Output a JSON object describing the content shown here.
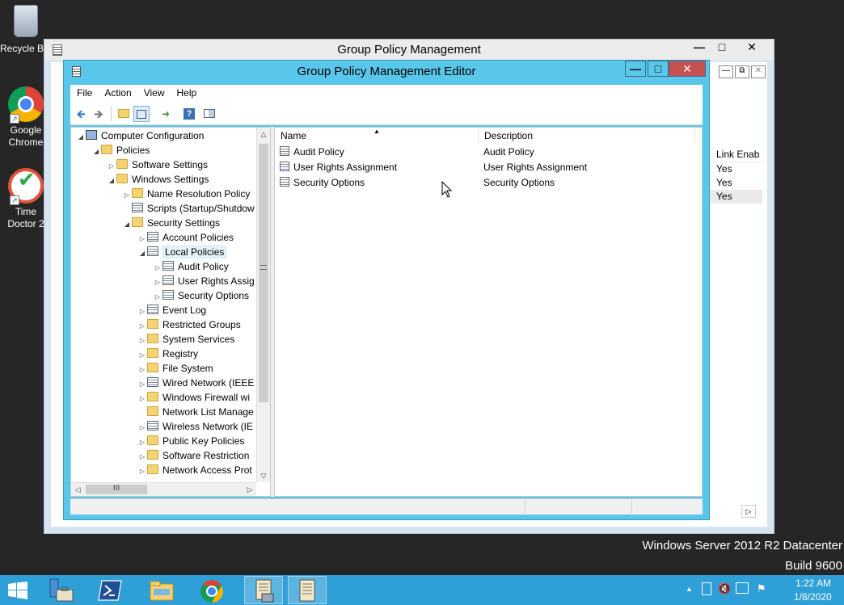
{
  "desktop": {
    "icons": [
      {
        "label": "Recycle Bin",
        "icon": "recycle-bin-icon"
      },
      {
        "label": "Google Chrome",
        "icon": "chrome-icon"
      },
      {
        "label": "Time Doctor 2",
        "icon": "time-doctor-icon"
      }
    ],
    "watermark_line1": "Windows Server 2012 R2 Datacenter",
    "watermark_line2": "Build 9600"
  },
  "gpm_window": {
    "title": "Group Policy Management",
    "right_column_header": "Link Enab",
    "right_column_values": [
      "Yes",
      "Yes",
      "Yes"
    ]
  },
  "editor": {
    "title": "Group Policy Management Editor",
    "menu": [
      "File",
      "Action",
      "View",
      "Help"
    ],
    "tree": [
      {
        "label": "Computer Configuration",
        "expanded": true
      },
      {
        "label": "Policies",
        "expanded": true
      },
      {
        "label": "Software Settings",
        "expanded": false
      },
      {
        "label": "Windows Settings",
        "expanded": true
      },
      {
        "label": "Name Resolution Policy",
        "expanded": false
      },
      {
        "label": "Scripts (Startup/Shutdow"
      },
      {
        "label": "Security Settings",
        "expanded": true
      },
      {
        "label": "Account Policies",
        "expanded": false
      },
      {
        "label": "Local Policies",
        "expanded": true,
        "selected": true
      },
      {
        "label": "Audit Policy",
        "expanded": false
      },
      {
        "label": "User Rights Assig",
        "expanded": false
      },
      {
        "label": "Security Options",
        "expanded": false
      },
      {
        "label": "Event Log",
        "expanded": false
      },
      {
        "label": "Restricted Groups",
        "expanded": false
      },
      {
        "label": "System Services",
        "expanded": false
      },
      {
        "label": "Registry",
        "expanded": false
      },
      {
        "label": "File System",
        "expanded": false
      },
      {
        "label": "Wired Network (IEEE",
        "expanded": false
      },
      {
        "label": "Windows Firewall wi",
        "expanded": false
      },
      {
        "label": "Network List Manage"
      },
      {
        "label": "Wireless Network (IE",
        "expanded": false
      },
      {
        "label": "Public Key Policies",
        "expanded": false
      },
      {
        "label": "Software Restriction",
        "expanded": false
      },
      {
        "label": "Network Access Prot",
        "expanded": false
      }
    ],
    "list_columns": {
      "name": "Name",
      "description": "Description"
    },
    "list_rows": [
      {
        "name": "Audit Policy",
        "description": "Audit Policy"
      },
      {
        "name": "User Rights Assignment",
        "description": "User Rights Assignment"
      },
      {
        "name": "Security Options",
        "description": "Security Options"
      }
    ]
  },
  "taskbar": {
    "time": "1:22 AM",
    "date": "1/8/2020",
    "buttons": [
      "start-icon",
      "server-manager-icon",
      "powershell-icon",
      "file-explorer-icon",
      "chrome-icon",
      "group-policy-management-icon",
      "group-policy-editor-icon"
    ]
  }
}
